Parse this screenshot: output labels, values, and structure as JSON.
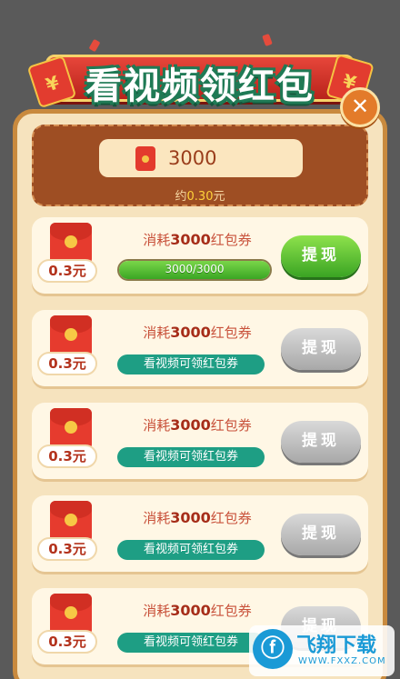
{
  "banner": {
    "title": "看视频领红包"
  },
  "close": {
    "label": "✕"
  },
  "balance": {
    "amount": "3000",
    "approx_prefix": "约",
    "approx_value": "0.30",
    "approx_unit": "元"
  },
  "cards": [
    {
      "price": "0.3元",
      "cost_prefix": "消耗",
      "cost_value": "3000",
      "cost_suffix": "红包券",
      "progress_text": "3000/3000",
      "progress_fraction": 1.0,
      "hint": "",
      "button": "提现",
      "button_state": "active"
    },
    {
      "price": "0.3元",
      "cost_prefix": "消耗",
      "cost_value": "3000",
      "cost_suffix": "红包券",
      "progress_text": "",
      "hint": "看视频可领红包券",
      "button": "提现",
      "button_state": "disabled"
    },
    {
      "price": "0.3元",
      "cost_prefix": "消耗",
      "cost_value": "3000",
      "cost_suffix": "红包券",
      "progress_text": "",
      "hint": "看视频可领红包券",
      "button": "提现",
      "button_state": "disabled"
    },
    {
      "price": "0.3元",
      "cost_prefix": "消耗",
      "cost_value": "3000",
      "cost_suffix": "红包券",
      "progress_text": "",
      "hint": "看视频可领红包券",
      "button": "提现",
      "button_state": "disabled"
    },
    {
      "price": "0.3元",
      "cost_prefix": "消耗",
      "cost_value": "3000",
      "cost_suffix": "红包券",
      "progress_text": "",
      "hint": "看视频可领红包券",
      "button": "提现",
      "button_state": "disabled"
    }
  ],
  "watermark": {
    "text": "飞翔下载",
    "url": "WWW.FXXZ.COM",
    "logo": "ⓕ"
  },
  "colors": {
    "panel": "#f6e3be",
    "balance_box": "#9e4e23",
    "active_button": "#3aa423",
    "disabled_button": "#a8a8a8",
    "hint_pill": "#1e9e84"
  }
}
